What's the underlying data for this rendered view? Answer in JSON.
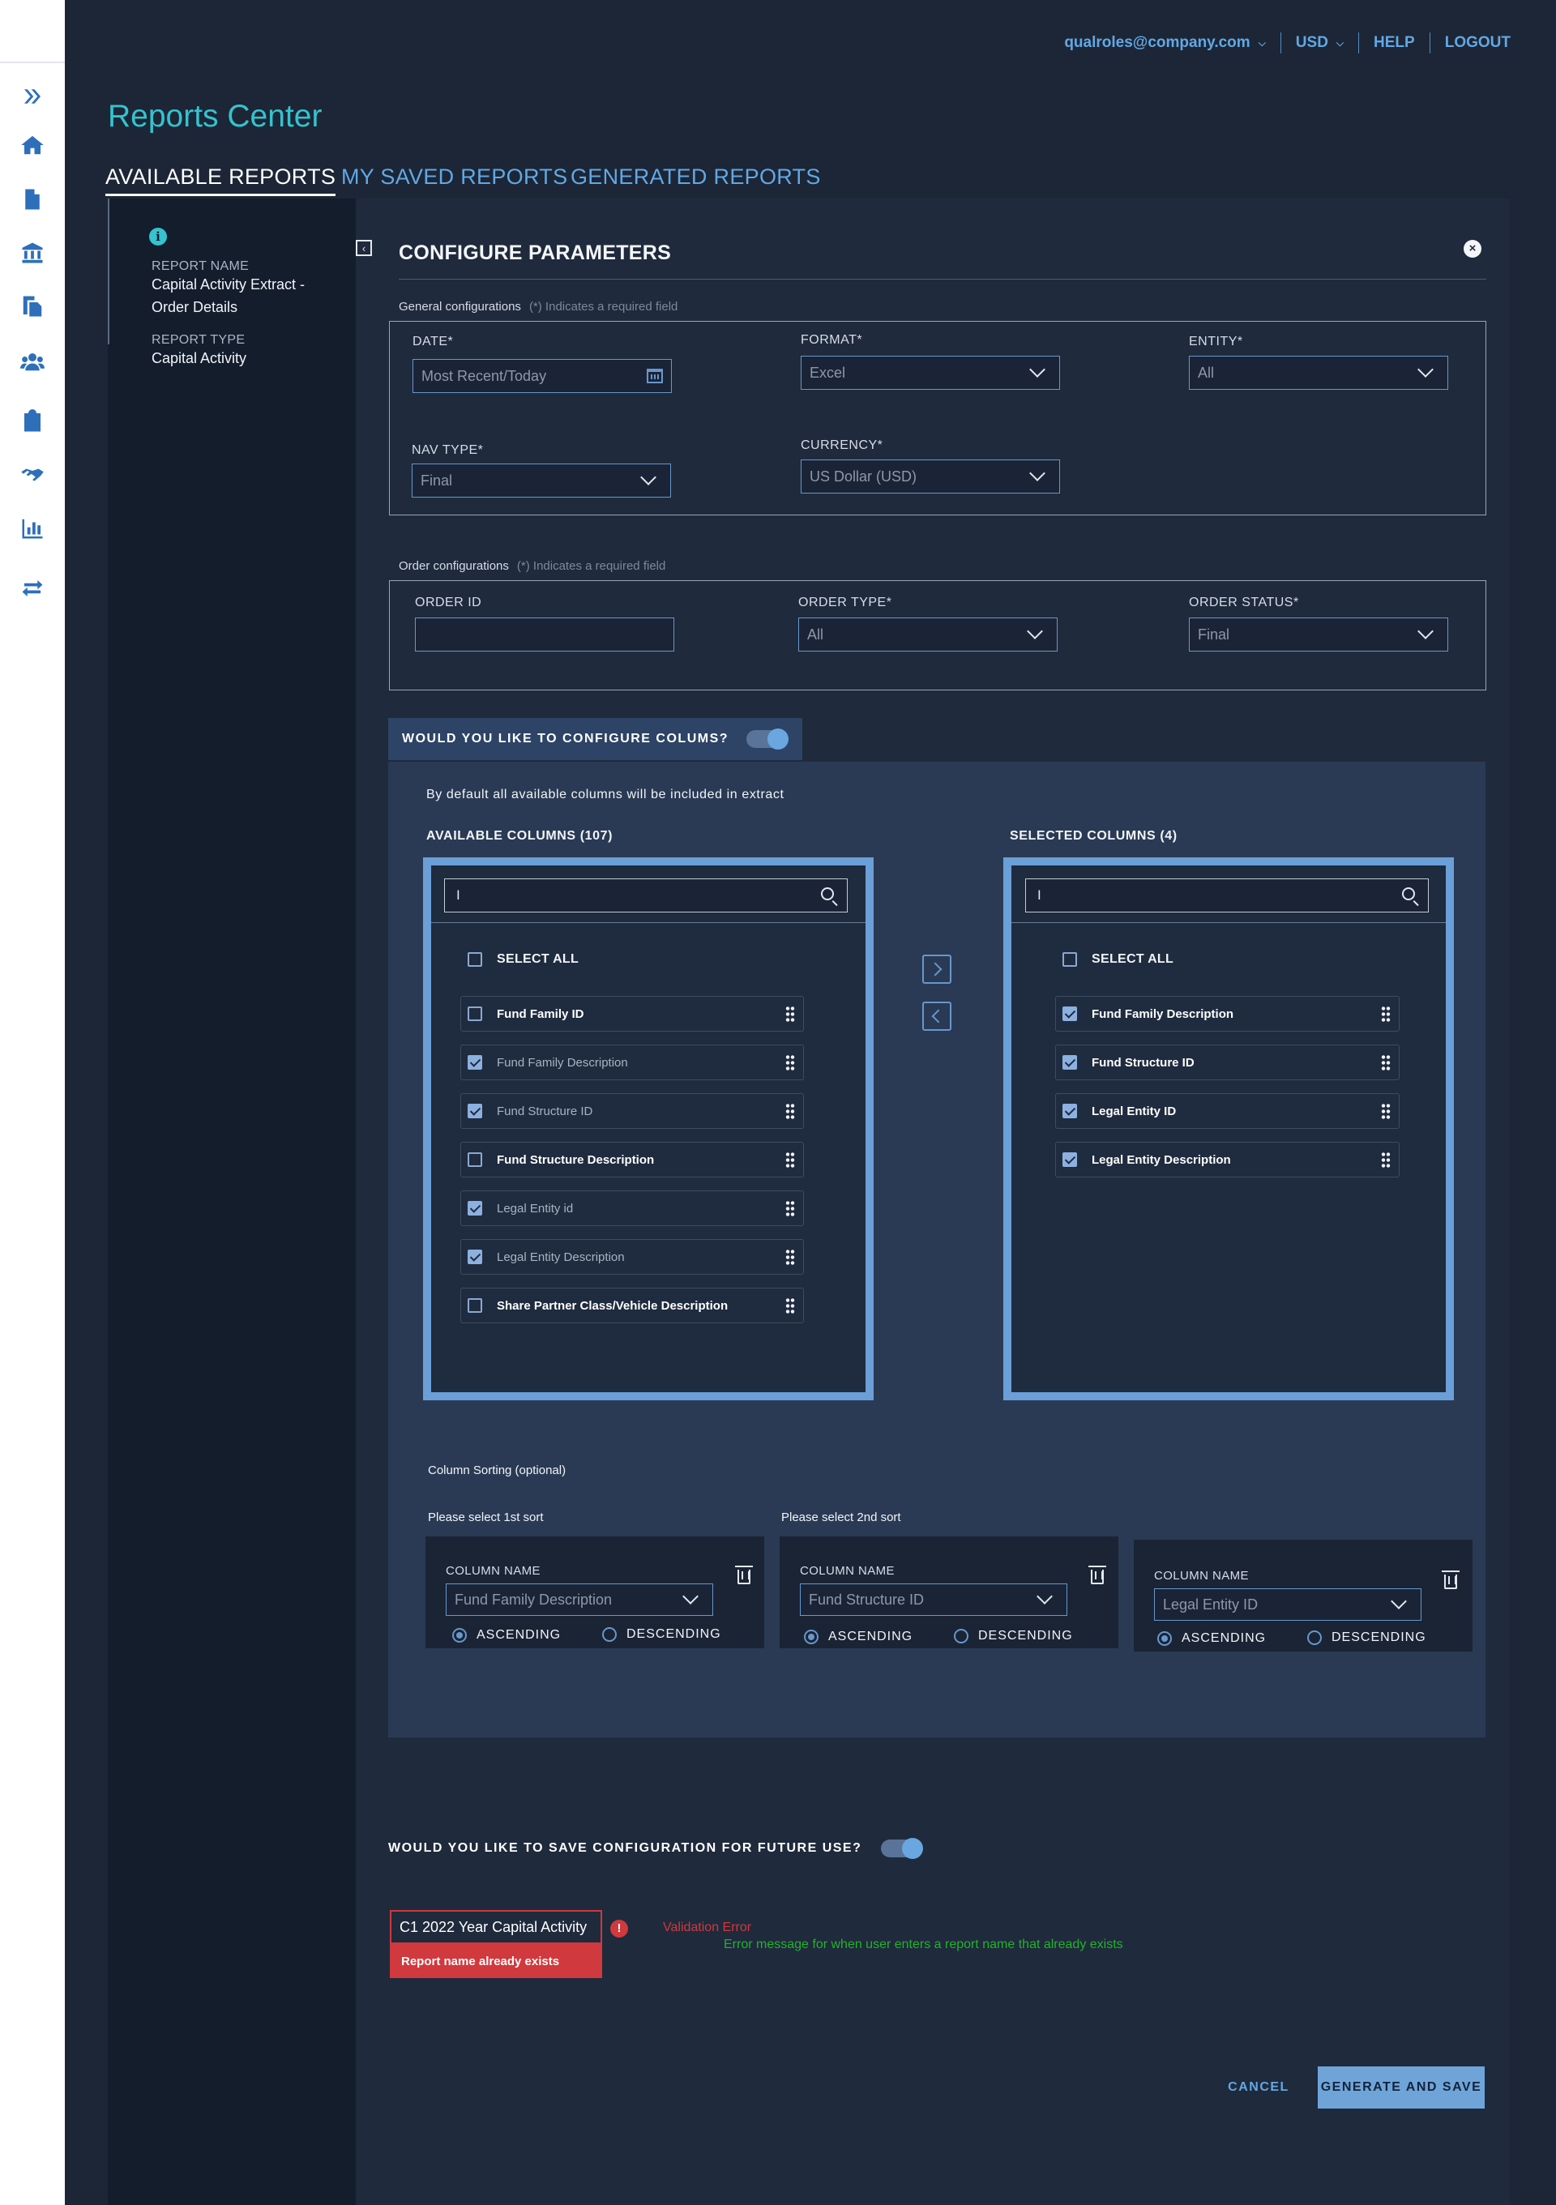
{
  "topnav": {
    "user_email": "qualroles@company.com",
    "currency": "USD",
    "help": "HELP",
    "logout": "LOGOUT"
  },
  "page": {
    "title": "Reports Center",
    "tabs": [
      "AVAILABLE REPORTS",
      "MY SAVED REPORTS",
      "GENERATED REPORTS"
    ],
    "active_tab": "AVAILABLE REPORTS"
  },
  "rail_icons": [
    "expand-icon",
    "home-icon",
    "document-icon",
    "bank-icon",
    "copy-documents-icon",
    "group-icon",
    "clipboard-icon",
    "handshake-icon",
    "bar-chart-icon",
    "transfer-icon"
  ],
  "report_info": {
    "name_label": "REPORT NAME",
    "name_line1": "Capital Activity Extract -",
    "name_line2": "Order Details",
    "type_label": "REPORT TYPE",
    "type_value": "Capital Activity"
  },
  "configure": {
    "title": "CONFIGURE PARAMETERS",
    "general": {
      "caption": "General configurations",
      "hint": "(*) Indicates a required field",
      "date_label": "DATE*",
      "date_placeholder": "Most Recent/Today",
      "format_label": "FORMAT*",
      "format_value": "Excel",
      "entity_label": "ENTITY*",
      "entity_value": "All",
      "nav_type_label": "NAV TYPE*",
      "nav_type_value": "Final",
      "currency_label": "CURRENCY*",
      "currency_value": "US Dollar (USD)"
    },
    "order": {
      "caption": "Order configurations",
      "hint": "(*) Indicates a required field",
      "order_id_label": "ORDER ID",
      "order_id_value": "",
      "order_type_label": "ORDER TYPE*",
      "order_type_value": "All",
      "order_status_label": "ORDER STATUS*",
      "order_status_value": "Final"
    }
  },
  "columns": {
    "toggle_label": "WOULD YOU LIKE TO CONFIGURE COLUMS?",
    "toggle_on": true,
    "note": "By default all available columns will be included in extract",
    "available_title": "AVAILABLE COLUMNS (107)",
    "selected_title": "SELECTED COLUMNS (4)",
    "search_value": "I",
    "select_all": "SELECT ALL",
    "available": [
      {
        "label": "Fund Family ID",
        "checked": false
      },
      {
        "label": "Fund Family Description",
        "checked": true
      },
      {
        "label": "Fund Structure ID",
        "checked": true
      },
      {
        "label": "Fund Structure Description",
        "checked": false
      },
      {
        "label": "Legal Entity id",
        "checked": true
      },
      {
        "label": "Legal Entity Description",
        "checked": true
      },
      {
        "label": "Share Partner Class/Vehicle Description",
        "checked": false
      }
    ],
    "selected": [
      {
        "label": "Fund Family Description",
        "checked": true
      },
      {
        "label": "Fund Structure ID",
        "checked": true
      },
      {
        "label": "Legal Entity ID",
        "checked": true
      },
      {
        "label": "Legal Entity Description",
        "checked": true
      }
    ]
  },
  "sorting": {
    "caption": "Column Sorting (optional)",
    "first_caption": "Please select 1st sort",
    "second_caption": "Please select 2nd sort",
    "column_name_label": "COLUMN NAME",
    "ascending": "ASCENDING",
    "descending": "DESCENDING",
    "sorts": [
      {
        "value": "Fund Family Description",
        "order": "ascending"
      },
      {
        "value": "Fund Structure ID",
        "order": "ascending"
      },
      {
        "value": "Legal Entity ID",
        "order": "ascending"
      }
    ]
  },
  "save": {
    "toggle_label": "WOULD YOU LIKE TO SAVE CONFIGURATION FOR FUTURE USE?",
    "toggle_on": true,
    "name_value": "C1 2022 Year Capital Activity",
    "error_text": "Report name already exists",
    "validation_title": "Validation Error",
    "validation_note": "Error message for when user enters a report name that already exists"
  },
  "actions": {
    "cancel": "CANCEL",
    "generate": "GENERATE AND SAVE"
  }
}
